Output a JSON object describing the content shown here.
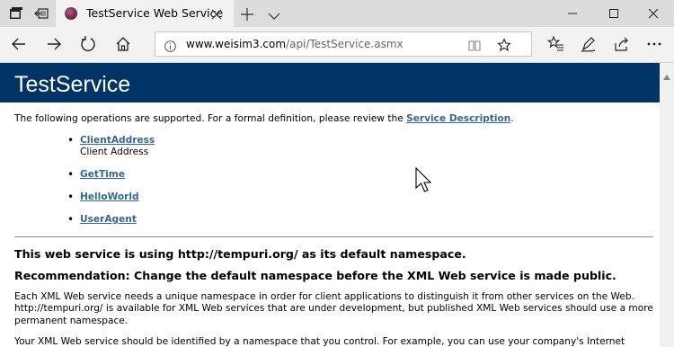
{
  "browser": {
    "tab": {
      "title": "TestService Web Service"
    },
    "address": {
      "host": "www.weisim3.com",
      "path": "/api/TestService.asmx"
    },
    "icons": [
      "tab-manager-icon",
      "set-aside-tabs-icon",
      "close-icon",
      "plus-icon",
      "chevron-down-icon",
      "minimize-icon",
      "maximize-icon",
      "close-window-icon",
      "back-icon",
      "forward-icon",
      "refresh-icon",
      "home-icon",
      "info-icon",
      "reading-view-icon",
      "star-icon",
      "favorites-icon",
      "pen-icon",
      "share-icon",
      "more-icon"
    ]
  },
  "page": {
    "heading": "TestService",
    "intro": {
      "text": "The following operations are supported. For a formal definition, please review the ",
      "link": "Service Description",
      "end": "."
    },
    "operations": [
      {
        "name": "ClientAddress",
        "desc": "Client Address"
      },
      {
        "name": "GetTime",
        "desc": ""
      },
      {
        "name": "HelloWorld",
        "desc": ""
      },
      {
        "name": "UserAgent",
        "desc": ""
      }
    ],
    "ns_heading": "This web service is using http://tempuri.org/ as its default namespace.",
    "rec_heading": "Recommendation: Change the default namespace before the XML Web service is made public.",
    "body1": "Each XML Web service needs a unique namespace in order for client applications to distinguish it from other services on the Web. http://tempuri.org/ is available for XML Web services that are under development, but published XML Web services should use a more permanent namespace.",
    "body2": "Your XML Web service should be identified by a namespace that you control. For example, you can use your company's Internet"
  },
  "colors": {
    "header_bg": "#003366",
    "link": "#336699",
    "chrome_bg": "#f2f2f2",
    "tabstrip_bg": "#dcdcdc"
  }
}
